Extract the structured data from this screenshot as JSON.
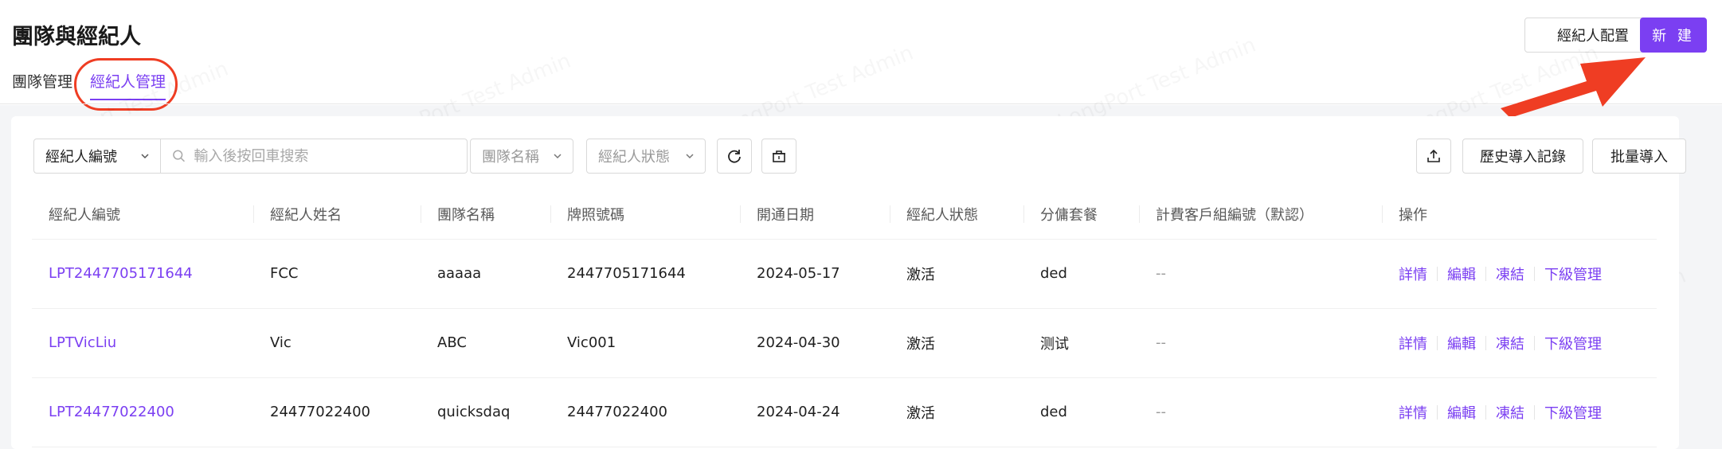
{
  "page": {
    "title": "團隊與經紀人"
  },
  "tabs": [
    {
      "label": "團隊管理",
      "active": false
    },
    {
      "label": "經紀人管理",
      "active": true
    }
  ],
  "header_buttons": {
    "config": "經紀人配置",
    "create": "新 建"
  },
  "filters": {
    "field_select": "經紀人編號",
    "search_placeholder": "輸入後按回車搜索",
    "team_placeholder": "團隊名稱",
    "status_placeholder": "經紀人狀態"
  },
  "toolbar_buttons": {
    "history": "歷史導入記錄",
    "batch_import": "批量導入"
  },
  "watermark": "LongPort Test Admin",
  "colors": {
    "accent": "#7b3ff2",
    "annotation": "#ef3d23"
  },
  "table": {
    "columns": [
      "經紀人編號",
      "經紀人姓名",
      "團隊名稱",
      "牌照號碼",
      "開通日期",
      "經紀人狀態",
      "分傭套餐",
      "計費客戶組編號（默認）",
      "操作"
    ],
    "actions": [
      "詳情",
      "編輯",
      "凍結",
      "下級管理"
    ],
    "rows": [
      {
        "id": "LPT2447705171644",
        "name": "FCC",
        "team": "aaaaa",
        "license": "2447705171644",
        "date": "2024-05-17",
        "status": "激活",
        "plan": "ded",
        "group": "--"
      },
      {
        "id": "LPTVicLiu",
        "name": "Vic",
        "team": "ABC",
        "license": "Vic001",
        "date": "2024-04-30",
        "status": "激活",
        "plan": "测试",
        "group": "--"
      },
      {
        "id": "LPT24477022400",
        "name": "24477022400",
        "team": "quicksdaq",
        "license": "24477022400",
        "date": "2024-04-24",
        "status": "激活",
        "plan": "ded",
        "group": "--"
      }
    ]
  }
}
